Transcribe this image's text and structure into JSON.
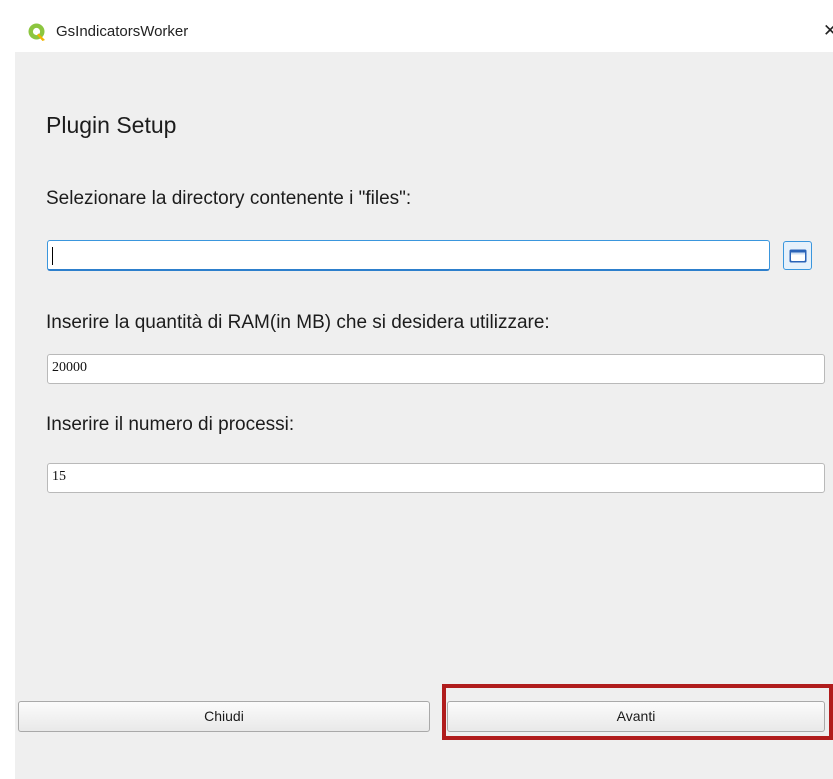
{
  "window": {
    "title": "GsIndicatorsWorker",
    "app_icon": "qgis-logo-icon",
    "close_glyph": "✕"
  },
  "main": {
    "heading": "Plugin Setup",
    "directory": {
      "label": "Selezionare la directory contenente i \"files\":",
      "value": "",
      "browse_icon": "folder-icon"
    },
    "ram": {
      "label": "Inserire la quantità di RAM(in MB) che si desidera utilizzare:",
      "value": "20000"
    },
    "processes": {
      "label": "Inserire il numero di processi:",
      "value": "15"
    }
  },
  "footer": {
    "close_label": "Chiudi",
    "next_label": "Avanti"
  },
  "colors": {
    "focus_border": "#3a96dd",
    "highlight_box": "#b01c1c",
    "dialog_background": "#efefef"
  }
}
